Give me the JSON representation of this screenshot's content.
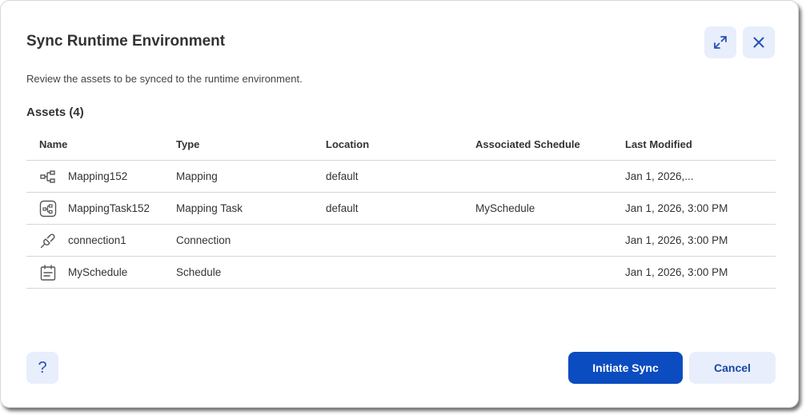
{
  "dialog": {
    "title": "Sync Runtime Environment",
    "subtitle": "Review the assets to be synced to the runtime environment.",
    "expand_icon": "expand-diagonal-arrows-icon",
    "close_icon": "close-x-icon"
  },
  "assets": {
    "heading": "Assets (4)",
    "columns": [
      "Name",
      "Type",
      "Location",
      "Associated Schedule",
      "Last Modified"
    ],
    "rows": [
      {
        "icon": "mapping-icon",
        "name": "Mapping152",
        "type": "Mapping",
        "location": "default",
        "schedule": "",
        "modified": "Jan 1, 2026,..."
      },
      {
        "icon": "mapping-task-icon",
        "name": "MappingTask152",
        "type": "Mapping Task",
        "location": "default",
        "schedule": "MySchedule",
        "modified": "Jan 1, 2026, 3:00 PM"
      },
      {
        "icon": "connection-plug-icon",
        "name": "connection1",
        "type": "Connection",
        "location": "",
        "schedule": "",
        "modified": "Jan 1, 2026, 3:00 PM"
      },
      {
        "icon": "schedule-calendar-icon",
        "name": "MySchedule",
        "type": "Schedule",
        "location": "",
        "schedule": "",
        "modified": "Jan 1, 2026, 3:00 PM"
      }
    ]
  },
  "footer": {
    "help_label": "?",
    "primary_label": "Initiate Sync",
    "secondary_label": "Cancel"
  },
  "colors": {
    "primary": "#0b4cc0",
    "secondary_bg": "#e8eefb",
    "icon_blue": "#2451b7",
    "divider": "#d6d6d6"
  }
}
